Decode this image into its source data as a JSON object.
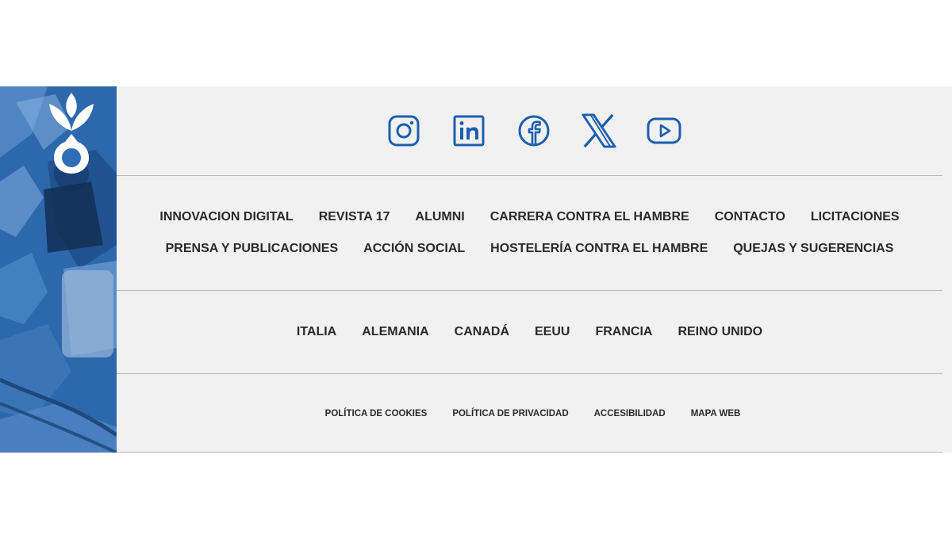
{
  "social": {
    "instagram": "instagram-icon",
    "linkedin": "linkedin-icon",
    "facebook": "facebook-icon",
    "x": "x-icon",
    "youtube": "youtube-icon",
    "icon_color": "#1b5fae"
  },
  "nav": {
    "row1": [
      "INNOVACION DIGITAL",
      "REVISTA 17",
      "ALUMNI",
      "CARRERA CONTRA EL HAMBRE",
      "CONTACTO",
      "LICITACIONES"
    ],
    "row2": [
      "PRENSA Y PUBLICACIONES",
      "ACCIÓN SOCIAL",
      "HOSTELERÍA CONTRA EL HAMBRE",
      "QUEJAS Y SUGERENCIAS"
    ]
  },
  "countries": [
    "ITALIA",
    "ALEMANIA",
    "CANADÁ",
    "EEUU",
    "FRANCIA",
    "REINO UNIDO"
  ],
  "legal": [
    "POLÍTICA DE COOKIES",
    "POLÍTICA DE PRIVACIDAD",
    "ACCESIBILIDAD",
    "MAPA WEB"
  ],
  "colors": {
    "brand_blue": "#2f6fb7",
    "footer_bg": "#f1f1f1",
    "text": "#2a2a2a"
  }
}
